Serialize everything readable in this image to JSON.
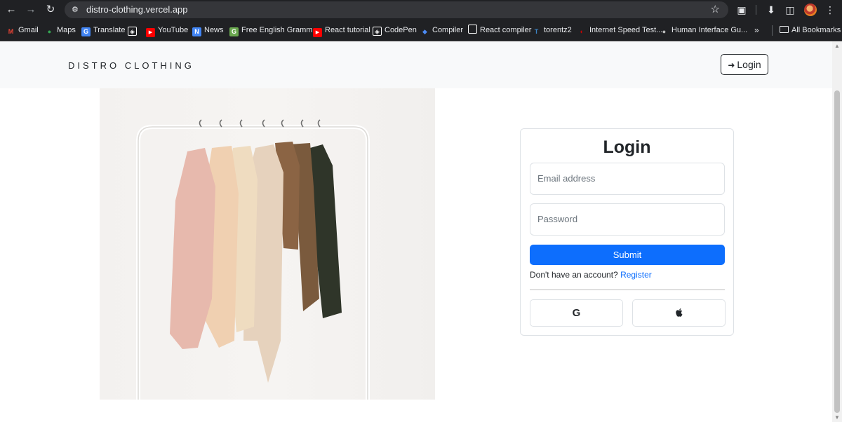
{
  "browser": {
    "url": "distro-clothing.vercel.app",
    "bookmarks": [
      {
        "label": "Gmail",
        "icon": "gmail-icon",
        "color": "#ea4335"
      },
      {
        "label": "Maps",
        "icon": "maps-icon",
        "color": "#34a853"
      },
      {
        "label": "Translate",
        "icon": "translate-icon",
        "color": "#4285f4"
      },
      {
        "label": "",
        "icon": "codepen-icon",
        "color": "#ffffff"
      },
      {
        "label": "YouTube",
        "icon": "youtube-icon",
        "color": "#ff0000"
      },
      {
        "label": "News",
        "icon": "news-icon",
        "color": "#4285f4"
      },
      {
        "label": "Free English Gramm...",
        "icon": "grammar-icon",
        "color": "#6aa84f"
      },
      {
        "label": "React tutorial",
        "icon": "youtube-icon",
        "color": "#ff0000"
      },
      {
        "label": "CodePen",
        "icon": "codepen-icon",
        "color": "#ffffff"
      },
      {
        "label": "Compiler",
        "icon": "compiler-icon",
        "color": "#4c8bf5"
      },
      {
        "label": "React compiler",
        "icon": "square-icon",
        "color": "#ffffff"
      },
      {
        "label": "torentz2",
        "icon": "torrent-icon",
        "color": "#3d85c6"
      },
      {
        "label": "Internet Speed Test...",
        "icon": "speedtest-icon",
        "color": "#cc0000"
      },
      {
        "label": "Human Interface Gu...",
        "icon": "apple-icon",
        "color": "#bbbbbb"
      }
    ],
    "more_label": "»",
    "all_bookmarks_label": "All Bookmarks"
  },
  "site": {
    "brand": "DISTRO CLOTHING",
    "header_login_label": "Login"
  },
  "login_form": {
    "title": "Login",
    "email_placeholder": "Email address",
    "password_placeholder": "Password",
    "submit_label": "Submit",
    "register_prompt": "Don't have an account?",
    "register_link": "Register",
    "google_label": "G",
    "apple_label": ""
  },
  "colors": {
    "primary": "#0d6efd",
    "header_bg": "#f8f9fa",
    "chrome_bg": "#202124"
  }
}
